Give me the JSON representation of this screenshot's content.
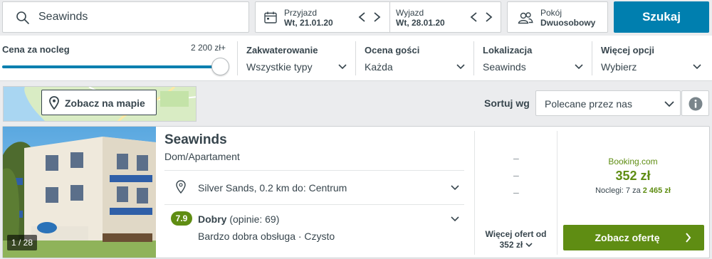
{
  "search": {
    "query": "Seawinds"
  },
  "dates": {
    "checkin_label": "Przyjazd",
    "checkin_value": "Wt, 21.01.20",
    "checkout_label": "Wyjazd",
    "checkout_value": "Wt, 28.01.20"
  },
  "rooms": {
    "label": "Pokój",
    "value": "Dwuosobowy"
  },
  "search_button": "Szukaj",
  "filters": {
    "price_label": "Cena za nocleg",
    "price_max": "2 200 zł+",
    "price_slider_fraction": 1.0,
    "accommodation": {
      "title": "Zakwaterowanie",
      "value": "Wszystkie typy"
    },
    "rating": {
      "title": "Ocena gości",
      "value": "Każda"
    },
    "location": {
      "title": "Lokalizacja",
      "value": "Seawinds"
    },
    "more": {
      "title": "Więcej opcji",
      "value": "Wybierz"
    }
  },
  "map_button": "Zobacz na mapie",
  "sort": {
    "label": "Sortuj wg",
    "value": "Polecane przez nas"
  },
  "result": {
    "photo_counter": "1 / 28",
    "name": "Seawinds",
    "type": "Dom/Apartament",
    "location": "Silver Sands, 0.2 km do: Centrum",
    "rating_score": "7.9",
    "rating_word": "Dobry",
    "rating_reviews": "(opinie: 69)",
    "highlights": "Bardzo dobra obsługa · Czysto",
    "dash": "–",
    "more_offers_line1": "Więcej ofert od",
    "more_offers_line2": "352 zł",
    "provider": "Booking.com",
    "price": "352 zł",
    "nights_prefix": "Noclegi: 7 za",
    "nights_total": "2 465 zł",
    "offer_button": "Zobacz ofertę"
  },
  "colors": {
    "accent": "#007faf",
    "green": "#5f8d13",
    "text": "#37454d"
  }
}
